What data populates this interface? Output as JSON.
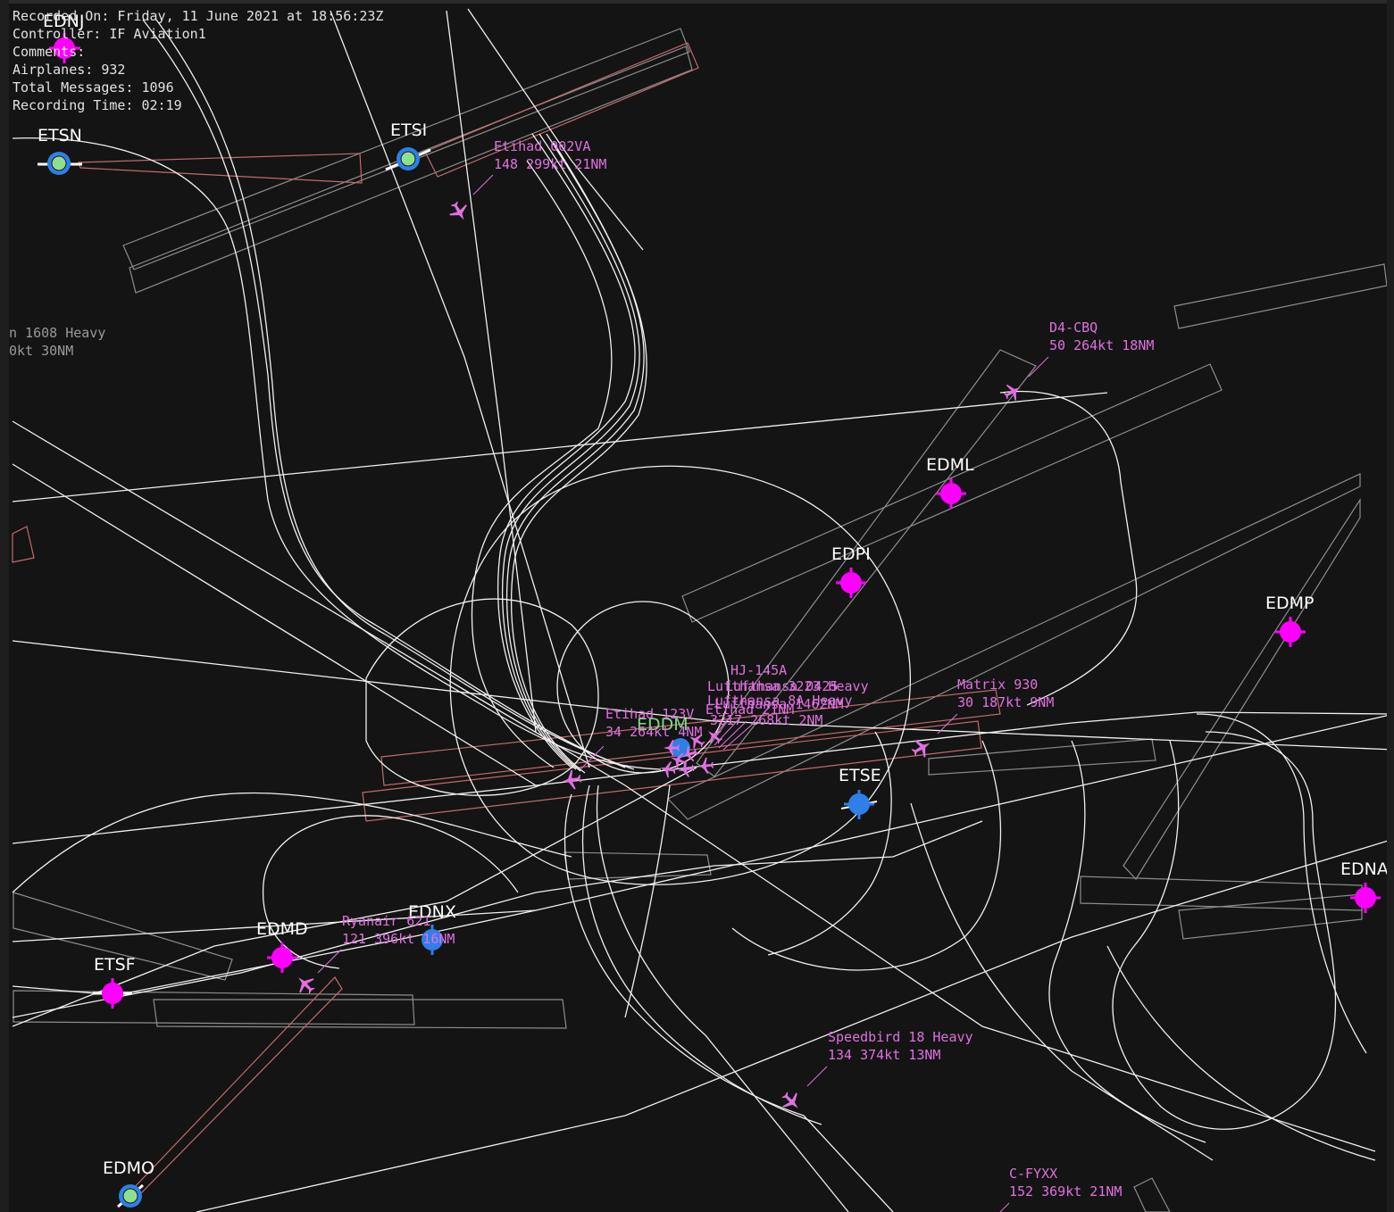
{
  "recording": {
    "recorded_on": "Recorded On: Friday, 11 June 2021 at 18:56:23Z",
    "controller": "Controller: IF Aviation1",
    "comments": "Comments:",
    "airplanes": "Airplanes: 932",
    "total_messages": "Total Messages: 1096",
    "recording_time": "Recording Time: 02:19"
  },
  "colors": {
    "background": "#141414",
    "track": "#f0f0f0",
    "runway_zone": "#9a9a9a",
    "active_zone": "#c46a6a",
    "aircraft": "#e070e0",
    "airport_magenta": "#ff00ff",
    "airport_blue": "#2f7fe8",
    "airport_green": "#8ee08e"
  },
  "airports": [
    {
      "code": "EDNJ",
      "style": "magenta",
      "icon": "airport-magenta-icon"
    },
    {
      "code": "ETSN",
      "style": "blue-green",
      "icon": "airport-blue-green-icon"
    },
    {
      "code": "ETSI",
      "style": "blue-green",
      "icon": "airport-blue-green-icon"
    },
    {
      "code": "EDML",
      "style": "magenta",
      "icon": "airport-magenta-icon"
    },
    {
      "code": "EDPI",
      "style": "magenta",
      "icon": "airport-magenta-icon"
    },
    {
      "code": "EDMP",
      "style": "magenta",
      "icon": "airport-magenta-icon"
    },
    {
      "code": "EDDM",
      "style": "green",
      "icon": "airport-blue-icon"
    },
    {
      "code": "ETSE",
      "style": "blue",
      "icon": "airport-blue-icon"
    },
    {
      "code": "EDNA",
      "style": "magenta",
      "icon": "airport-magenta-icon"
    },
    {
      "code": "EDMD",
      "style": "magenta",
      "icon": "airport-magenta-icon"
    },
    {
      "code": "EDNX",
      "style": "blue",
      "icon": "airport-blue-icon"
    },
    {
      "code": "ETSF",
      "style": "magenta",
      "icon": "airport-magenta-icon"
    },
    {
      "code": "EDMO",
      "style": "blue-green",
      "icon": "airport-blue-green-icon"
    }
  ],
  "aircraft": [
    {
      "callsign": "Etihad 002VA",
      "info": "148 299kt 21NM",
      "icon": "airplane-icon"
    },
    {
      "callsign": "D4-CBQ",
      "info": "50 264kt 18NM",
      "icon": "airplane-icon"
    },
    {
      "callsign": "HJ-145A",
      "info": "",
      "icon": "airplane-icon"
    },
    {
      "callsign": "Matrix 930",
      "info": "30 187kt 9NM",
      "icon": "airplane-icon"
    },
    {
      "callsign": "Etihad 123V",
      "info": "34 264kt 4NM",
      "icon": "airplane-icon"
    },
    {
      "callsign": "Ryanair 621",
      "info": "121 396kt 16NM",
      "icon": "airplane-icon"
    },
    {
      "callsign": "Speedbird 18 Heavy",
      "info": "134 374kt 13NM",
      "icon": "airplane-icon"
    },
    {
      "callsign": "C-FYXX",
      "info": "152 369kt 21NM",
      "icon": "airplane-icon"
    }
  ],
  "edge_aircraft": {
    "line1": "n 1608 Heavy",
    "line2": "0kt 30NM"
  },
  "cluster_labels": [
    "Lufthansa 0425",
    "Lufthansa 3223 Heavy",
    "Lufthansa 8A Heavy",
    "Lufthansa 1462NM",
    "Etihad 21NM",
    "3217 268kt 2NM"
  ]
}
